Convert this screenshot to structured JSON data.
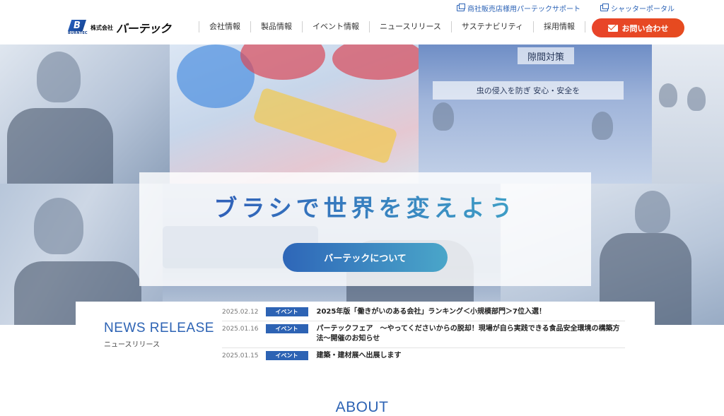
{
  "utility_links": [
    {
      "label": "商社販売店様用パーテックサポート"
    },
    {
      "label": "シャッターポータル"
    }
  ],
  "logo": {
    "mark": "B",
    "mark_sub": "BURNTEC",
    "company_prefix": "株式会社",
    "company_name": "バーテック"
  },
  "nav": {
    "items": [
      {
        "label": "会社情報"
      },
      {
        "label": "製品情報"
      },
      {
        "label": "イベント情報"
      },
      {
        "label": "ニュースリリース"
      },
      {
        "label": "サステナビリティ"
      },
      {
        "label": "採用情報"
      }
    ],
    "contact_label": "お問い合わせ"
  },
  "hero": {
    "sign_text": "隙間対策",
    "sign_text2": "虫の侵入を防ぎ 安心・安全を",
    "title": "ブラシで世界を変えよう",
    "button_label": "バーテックについて"
  },
  "news": {
    "title": "NEWS RELEASE",
    "subtitle": "ニュースリリース",
    "items": [
      {
        "date": "2025.02.12",
        "tag": "イベント",
        "text": "2025年版「働きがいのある会社」ランキング＜小規模部門＞7位入選！"
      },
      {
        "date": "2025.01.16",
        "tag": "イベント",
        "text": "パーテックフェア　〜やってくださいからの脱却！現場が自ら実践できる食品安全環境の構築方法〜開催のお知らせ"
      },
      {
        "date": "2025.01.15",
        "tag": "イベント",
        "text": "建築・建材展へ出展します"
      }
    ]
  },
  "about": {
    "heading": "ABOUT"
  }
}
